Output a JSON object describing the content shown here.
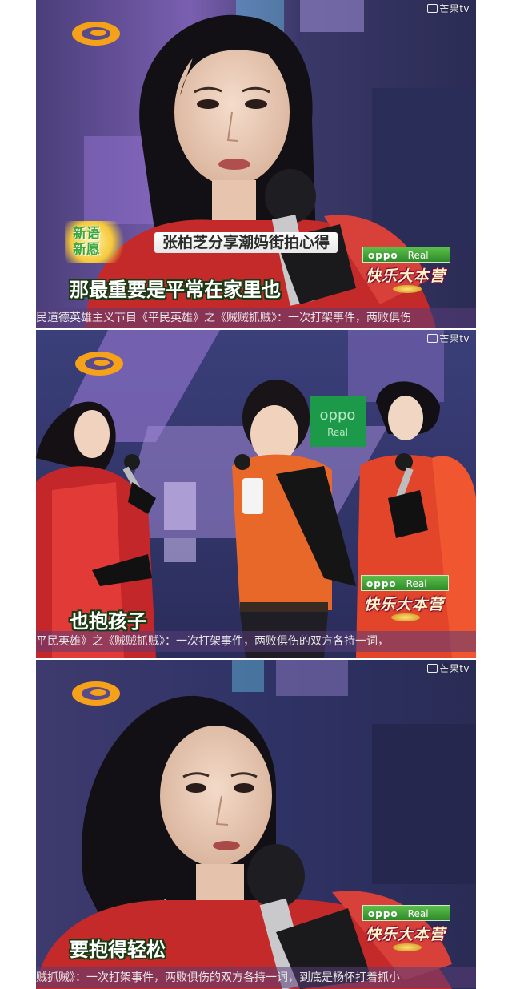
{
  "watermark": {
    "text": "芒果tv"
  },
  "panel1": {
    "subtitle": "那最重要是平常在家里也",
    "topic_badge": "新语新愿",
    "topic_title": "张柏芝分享潮妈街拍心得",
    "ticker": "民道德英雄主义节目《平民英雄》之《贼贼抓贼》：一次打架事件，两败俱伤"
  },
  "panel2": {
    "subtitle": "也抱孩子",
    "screen_sign": "oppo Real",
    "ticker": "平民英雄》之《贼贼抓贼》：一次打架事件，两败俱伤的双方各持一词，"
  },
  "panel3": {
    "subtitle": "要抱得轻松",
    "ticker": "贼抓贼》：一次打架事件，两败俱伤的双方各持一词，到底是杨怀打着抓小"
  },
  "sponsor": {
    "brand": "oppo",
    "sub": "Real",
    "show_name": "快乐大本营"
  },
  "colors": {
    "stage_purple": "#5b4a8a",
    "dress_red": "#d8322a",
    "logo_orange": "#f5a11a"
  }
}
